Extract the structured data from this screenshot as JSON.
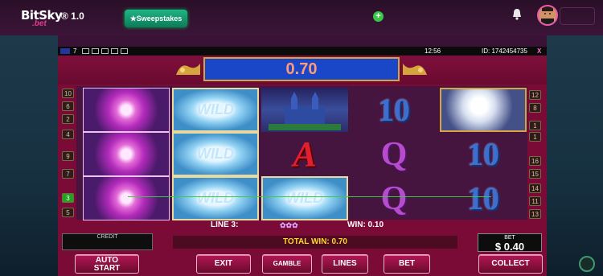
{
  "site": {
    "logo": "BitSky",
    "logo_sub": ".bet",
    "version": "® 1.0",
    "sweepstakes_label": "★Sweepstakes"
  },
  "statusbar": {
    "lines_count": "7",
    "time": "12:56",
    "id": "ID: 1742454735",
    "close": "X"
  },
  "game": {
    "win_display": "0.70",
    "line_info": "LINE 3:",
    "line_win": "WIN: 0.10",
    "total_win": "TOTAL WIN: 0.70",
    "credit_label": "CREDIT",
    "bet_label": "BET",
    "bet_value": "$ 0.40",
    "stars": "✿✿✿",
    "wild_label": "WILD"
  },
  "left_lines": [
    "10",
    "6",
    "2",
    "4",
    "9",
    "7",
    "3",
    "5"
  ],
  "right_lines": [
    "12",
    "8",
    "1",
    "1",
    "16",
    "15",
    "14",
    "11",
    "13"
  ],
  "reels": [
    [
      "lily",
      "lily",
      "lily"
    ],
    [
      "wild",
      "wild",
      "wild"
    ],
    [
      "castle",
      "ace",
      "wild"
    ],
    [
      "ten",
      "Q",
      "Q"
    ],
    [
      "unicorn",
      "ten",
      "ten"
    ]
  ],
  "buttons": {
    "auto_start": [
      "AUTO",
      "START"
    ],
    "exit": "EXIT",
    "gamble": "GAMBLE",
    "lines": "LINES",
    "bet": "BET",
    "collect": "COLLECT"
  },
  "symbols": {
    "ten": "10",
    "q": "Q",
    "ace": "A"
  },
  "colors": {
    "accent": "#e03b8f",
    "panel": "#7a0b36",
    "win_bg": "#1947c7"
  }
}
